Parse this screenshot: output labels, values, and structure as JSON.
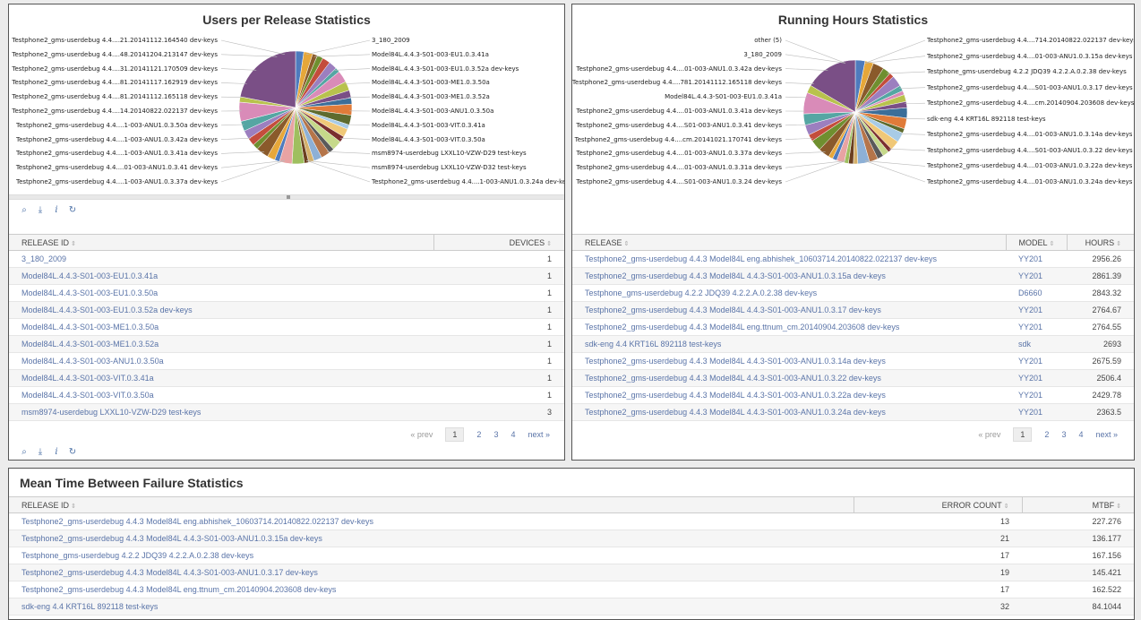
{
  "panel1": {
    "title": "Users per Release Statistics",
    "chart_data": {
      "type": "pie",
      "labels_left": [
        "Testphone2_gms-userdebug 4.4....21.20141112.164540 dev-keys",
        "Testphone2_gms-userdebug 4.4....48.20141204.213147 dev-keys",
        "Testphone2_gms-userdebug 4.4....31.20141121.170509 dev-keys",
        "Testphone2_gms-userdebug 4.4....81.20141117.162919 dev-keys",
        "Testphone2_gms-userdebug 4.4....81.20141112.165118 dev-keys",
        "Testphone2_gms-userdebug 4.4....14.20140822.022137 dev-keys",
        "Testphone2_gms-userdebug 4.4....1-003-ANU1.0.3.50a dev-keys",
        "Testphone2_gms-userdebug 4.4....1-003-ANU1.0.3.42a dev-keys",
        "Testphone2_gms-userdebug 4.4....1-003-ANU1.0.3.41a dev-keys",
        "Testphone2_gms-userdebug 4.4....01-003-ANU1.0.3.41 dev-keys",
        "Testphone2_gms-userdebug 4.4....1-003-ANU1.0.3.37a dev-keys"
      ],
      "labels_right": [
        "3_180_2009",
        "Model84L.4.4.3-S01-003-EU1.0.3.41a",
        "Model84L.4.4.3-S01-003-EU1.0.3.52a dev-keys",
        "Model84L.4.4.3-S01-003-ME1.0.3.50a",
        "Model84L.4.4.3-S01-003-ME1.0.3.52a",
        "Model84L.4.4.3-S01-003-ANU1.0.3.50a",
        "Model84L.4.4.3-S01-003-VIT.0.3.41a",
        "Model84L.4.4.3-S01-003-VIT.0.3.50a",
        "msm8974-userdebug LXXL10-VZW-D29 test-keys",
        "msm8974-userdebug LXXL10-VZW-D32 test-keys",
        "Testphone2_gms-userdebug 4.4....1-003-ANU1.0.3.24a dev-keys"
      ]
    },
    "table": {
      "headers": [
        "RELEASE ID",
        "DEVICES"
      ],
      "rows": [
        [
          "3_180_2009",
          "1"
        ],
        [
          "Model84L.4.4.3-S01-003-EU1.0.3.41a",
          "1"
        ],
        [
          "Model84L.4.4.3-S01-003-EU1.0.3.50a",
          "1"
        ],
        [
          "Model84L.4.4.3-S01-003-EU1.0.3.52a dev-keys",
          "1"
        ],
        [
          "Model84L.4.4.3-S01-003-ME1.0.3.50a",
          "1"
        ],
        [
          "Model84L.4.4.3-S01-003-ME1.0.3.52a",
          "1"
        ],
        [
          "Model84L.4.4.3-S01-003-ANU1.0.3.50a",
          "1"
        ],
        [
          "Model84L.4.4.3-S01-003-VIT.0.3.41a",
          "1"
        ],
        [
          "Model84L.4.4.3-S01-003-VIT.0.3.50a",
          "1"
        ],
        [
          "msm8974-userdebug LXXL10-VZW-D29 test-keys",
          "3"
        ]
      ]
    },
    "pager": {
      "prev": "« prev",
      "pages": [
        "1",
        "2",
        "3",
        "4"
      ],
      "next": "next »"
    }
  },
  "panel2": {
    "title": "Running Hours Statistics",
    "chart_data": {
      "type": "pie",
      "labels_left": [
        "other (5)",
        "3_180_2009",
        "Testphone2_gms-userdebug 4.4....01-003-ANU1.0.3.42a dev-keys",
        "Testphone2_gms-userdebug 4.4....781.20141112.165118 dev-keys",
        "Model84L.4.4.3-S01-003-EU1.0.3.41a",
        "Testphone2_gms-userdebug 4.4....01-003-ANU1.0.3.41a dev-keys",
        "Testphone2_gms-userdebug 4.4....S01-003-ANU1.0.3.41 dev-keys",
        "Testphone2_gms-userdebug 4.4....cm.20141021.170741 dev-keys",
        "Testphone2_gms-userdebug 4.4....01-003-ANU1.0.3.37a dev-keys",
        "Testphone2_gms-userdebug 4.4....01-003-ANU1.0.3.31a dev-keys",
        "Testphone2_gms-userdebug 4.4....S01-003-ANU1.0.3.24 dev-keys"
      ],
      "labels_right": [
        "Testphone2_gms-userdebug 4.4....714.20140822.022137 dev-keys",
        "Testphone2_gms-userdebug 4.4....01-003-ANU1.0.3.15a dev-keys",
        "Testphone_gms-userdebug 4.2.2 JDQ39 4.2.2.A.0.2.38 dev-keys",
        "Testphone2_gms-userdebug 4.4....S01-003-ANU1.0.3.17 dev-keys",
        "Testphone2_gms-userdebug 4.4....cm.20140904.203608 dev-keys",
        "sdk-eng 4.4 KRT16L 892118 test-keys",
        "Testphone2_gms-userdebug 4.4....01-003-ANU1.0.3.14a dev-keys",
        "Testphone2_gms-userdebug 4.4....S01-003-ANU1.0.3.22 dev-keys",
        "Testphone2_gms-userdebug 4.4....01-003-ANU1.0.3.22a dev-keys",
        "Testphone2_gms-userdebug 4.4....01-003-ANU1.0.3.24a dev-keys"
      ]
    },
    "table": {
      "headers": [
        "RELEASE",
        "MODEL",
        "HOURS"
      ],
      "rows": [
        [
          "Testphone2_gms-userdebug 4.4.3 Model84L eng.abhishek_10603714.20140822.022137 dev-keys",
          "YY201",
          "2956.26"
        ],
        [
          "Testphone2_gms-userdebug 4.4.3 Model84L 4.4.3-S01-003-ANU1.0.3.15a dev-keys",
          "YY201",
          "2861.39"
        ],
        [
          "Testphone_gms-userdebug 4.2.2 JDQ39 4.2.2.A.0.2.38 dev-keys",
          "D6660",
          "2843.32"
        ],
        [
          "Testphone2_gms-userdebug 4.4.3 Model84L 4.4.3-S01-003-ANU1.0.3.17 dev-keys",
          "YY201",
          "2764.67"
        ],
        [
          "Testphone2_gms-userdebug 4.4.3 Model84L eng.ttnum_cm.20140904.203608 dev-keys",
          "YY201",
          "2764.55"
        ],
        [
          "sdk-eng 4.4 KRT16L 892118 test-keys",
          "sdk",
          "2693"
        ],
        [
          "Testphone2_gms-userdebug 4.4.3 Model84L 4.4.3-S01-003-ANU1.0.3.14a dev-keys",
          "YY201",
          "2675.59"
        ],
        [
          "Testphone2_gms-userdebug 4.4.3 Model84L 4.4.3-S01-003-ANU1.0.3.22 dev-keys",
          "YY201",
          "2506.4"
        ],
        [
          "Testphone2_gms-userdebug 4.4.3 Model84L 4.4.3-S01-003-ANU1.0.3.22a dev-keys",
          "YY201",
          "2429.78"
        ],
        [
          "Testphone2_gms-userdebug 4.4.3 Model84L 4.4.3-S01-003-ANU1.0.3.24a dev-keys",
          "YY201",
          "2363.5"
        ]
      ]
    },
    "pager": {
      "prev": "« prev",
      "pages": [
        "1",
        "2",
        "3",
        "4"
      ],
      "next": "next »"
    }
  },
  "panel3": {
    "title": "Mean Time Between Failure Statistics",
    "table": {
      "headers": [
        "RELEASE ID",
        "ERROR COUNT",
        "MTBF"
      ],
      "rows": [
        [
          "Testphone2_gms-userdebug 4.4.3 Model84L eng.abhishek_10603714.20140822.022137 dev-keys",
          "13",
          "227.276"
        ],
        [
          "Testphone2_gms-userdebug 4.4.3 Model84L 4.4.3-S01-003-ANU1.0.3.15a dev-keys",
          "21",
          "136.177"
        ],
        [
          "Testphone_gms-userdebug 4.2.2 JDQ39 4.2.2.A.0.2.38 dev-keys",
          "17",
          "167.156"
        ],
        [
          "Testphone2_gms-userdebug 4.4.3 Model84L 4.4.3-S01-003-ANU1.0.3.17 dev-keys",
          "19",
          "145.421"
        ],
        [
          "Testphone2_gms-userdebug 4.4.3 Model84L eng.ttnum_cm.20140904.203608 dev-keys",
          "17",
          "162.522"
        ],
        [
          "sdk-eng 4.4 KRT16L 892118 test-keys",
          "32",
          "84.1044"
        ]
      ]
    }
  },
  "toolbar_icons": [
    "search-icon",
    "download-icon",
    "info-icon",
    "refresh-icon"
  ]
}
